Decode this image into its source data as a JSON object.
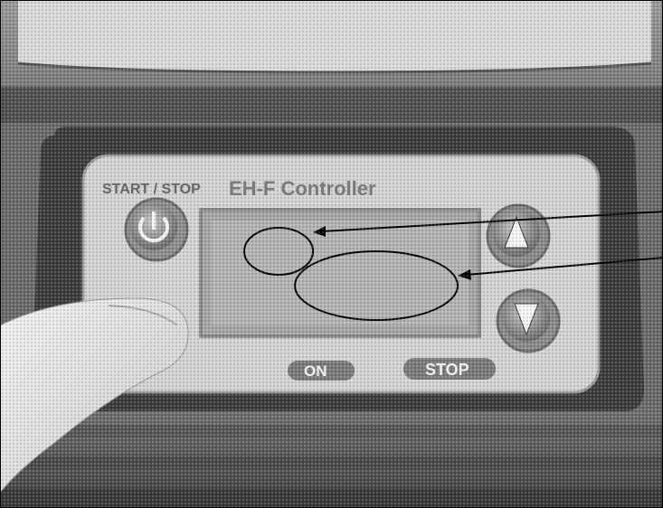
{
  "photo": {
    "subject": "EH-F controller keypad with display",
    "controller_label": "EH-F Controller",
    "start_stop_label": "START / STOP",
    "on_label": "ON",
    "stop_label": "STOP",
    "icons": {
      "power": "power-icon",
      "up": "arrow-up-icon",
      "down": "arrow-down-icon"
    },
    "colors": {
      "background": "#ffffff",
      "housing": "#5a5a5a",
      "panel": "#cfcfcf",
      "display": "#a9a9a9",
      "button": "#8a8a8a",
      "outline": "#000000"
    }
  }
}
